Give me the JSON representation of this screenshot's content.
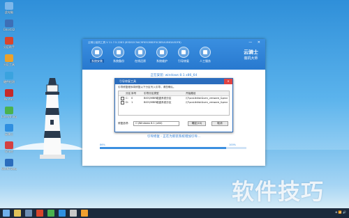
{
  "desktop": {
    "icons": [
      {
        "label": "此电脑",
        "color": "#7db7ea"
      },
      {
        "label": "Ghost32",
        "color": "#3d6fb6"
      },
      {
        "label": "分区助手",
        "color": "#d8452c"
      },
      {
        "label": "分区工具",
        "color": "#eaa12c"
      },
      {
        "label": "硬件检测",
        "color": "#3aa3df"
      },
      {
        "label": "Norton",
        "color": "#c52a2a"
      },
      {
        "label": "Everything",
        "color": "#4ab24e"
      },
      {
        "label": "云骑士",
        "color": "#2f8fe0"
      },
      {
        "label": "Ghost",
        "color": "#d34040"
      },
      {
        "label": "WinNTSetup",
        "color": "#2b6dbd"
      }
    ]
  },
  "window": {
    "title": "云骑士装机工具 V 11.7.5.2283 (85D02C9AC9F65C6BDF0C8E0A1B63A5DFB)",
    "controls": "— ✕",
    "nav": [
      {
        "label": "系统安装",
        "active": true
      },
      {
        "label": "系统备份",
        "active": false
      },
      {
        "label": "在线还原",
        "active": false
      },
      {
        "label": "系统维护",
        "active": false
      },
      {
        "label": "引导修复",
        "active": false
      },
      {
        "label": "人工服务",
        "active": false
      }
    ],
    "brand": {
      "name": "云骑士",
      "sub": "装机大师"
    },
    "status_top": "正在安装: windows 8.1 x86_64",
    "status_bottom": "引导修复 - 正在为新装系统增加引导...",
    "progress": {
      "left": "86%",
      "right": "100%",
      "value": 0.86
    }
  },
  "dialog": {
    "title": "引导修复工具",
    "close": "✕",
    "desc": "引导修复程序将修复以下分区写入引导，请您确认。",
    "columns": [
      "分区",
      "序号",
      "引导分区类型",
      "开始路径"
    ],
    "rows": [
      {
        "part": "C:",
        "idx": "0",
        "type": "BIOS/MBR磁盘系统分区",
        "path": "\\\\?\\scsi#disk&ven_vmware_&prod"
      },
      {
        "part": "D:",
        "idx": "1",
        "type": "BIOS/MBR磁盘系统分区",
        "path": "\\\\?\\scsi#disk&ven_vmware_&prod"
      }
    ],
    "footer": {
      "label": "修复选项:",
      "select": "C:\\Windows 8.1 (x64)",
      "ok": "确定(10)",
      "cancel": "取消"
    }
  },
  "watermark": "软件技巧",
  "taskbar": {
    "icons": [
      {
        "name": "start",
        "color": "#6fb0ec"
      },
      {
        "name": "explorer",
        "color": "#e0c25a"
      },
      {
        "name": "network",
        "color": "#6d8fb5"
      },
      {
        "name": "partition",
        "color": "#d8452c"
      },
      {
        "name": "tool",
        "color": "#4ab24e"
      },
      {
        "name": "yunqishi",
        "color": "#2f8fe0"
      },
      {
        "name": "repair",
        "color": "#c8c8c8"
      },
      {
        "name": "browser",
        "color": "#f0a030"
      }
    ],
    "tray": "⊕ 📶 🔊"
  }
}
